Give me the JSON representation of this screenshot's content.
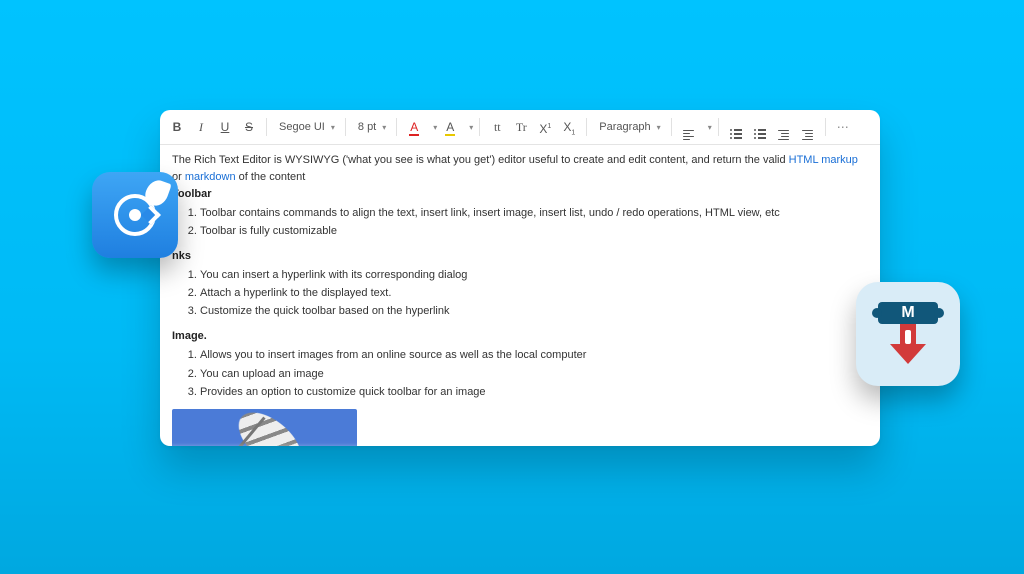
{
  "toolbar": {
    "bold": "B",
    "italic": "I",
    "underline": "U",
    "strike": "S",
    "font_family": "Segoe UI",
    "font_size": "8 pt",
    "font_color": "A",
    "highlight": "A",
    "case_lower": "tt",
    "case_upper": "Tr",
    "superscript": "X",
    "subscript": "X",
    "paragraph": "Paragraph"
  },
  "body": {
    "intro_before": "The Rich Text Editor is WYSIWYG ('what you see is what you get') editor useful to create and edit content, and return the valid ",
    "link_html": "HTML markup",
    "intro_mid": " or ",
    "link_md": "markdown",
    "intro_after": " of the content",
    "heading_toolbar": "Toolbar",
    "toolbar_items": [
      "Toolbar contains commands to align the text, insert link, insert image, insert list, undo / redo operations, HTML view, etc",
      "Toolbar is fully customizable"
    ],
    "heading_links": "nks",
    "links_items": [
      "You can insert a hyperlink with its corresponding dialog",
      "Attach a hyperlink to the displayed text.",
      "Customize the quick toolbar based on the hyperlink"
    ],
    "heading_image": "Image.",
    "image_items": [
      "Allows you to insert images from an online source as well as the local computer",
      "You can upload an image",
      "Provides an option to customize quick toolbar for an image"
    ]
  }
}
